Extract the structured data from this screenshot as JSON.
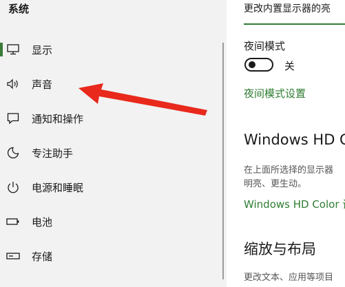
{
  "sidebar": {
    "title": "系统",
    "items": [
      {
        "label": "显示",
        "icon": "monitor-icon"
      },
      {
        "label": "声音",
        "icon": "speaker-icon"
      },
      {
        "label": "通知和操作",
        "icon": "notification-icon"
      },
      {
        "label": "专注助手",
        "icon": "moon-icon"
      },
      {
        "label": "电源和睡眠",
        "icon": "power-icon"
      },
      {
        "label": "电池",
        "icon": "battery-icon"
      },
      {
        "label": "存储",
        "icon": "storage-icon"
      }
    ]
  },
  "main": {
    "top_text": "更改内置显示器的亮",
    "night_mode": {
      "label": "夜间模式",
      "state": "关",
      "settings_link": "夜间模式设置"
    },
    "hd_color": {
      "heading": "Windows HD Co",
      "desc_line1": "在上面所选择的显示器",
      "desc_line2": "明亮、更生动。",
      "link": "Windows HD Color 设"
    },
    "scale": {
      "heading": "缩放与布局",
      "desc": "更改文本、应用等项目"
    }
  },
  "colors": {
    "accent": "#2e7d32",
    "arrow": "#e8291c",
    "sidebar_bg": "#f2f2f2"
  }
}
